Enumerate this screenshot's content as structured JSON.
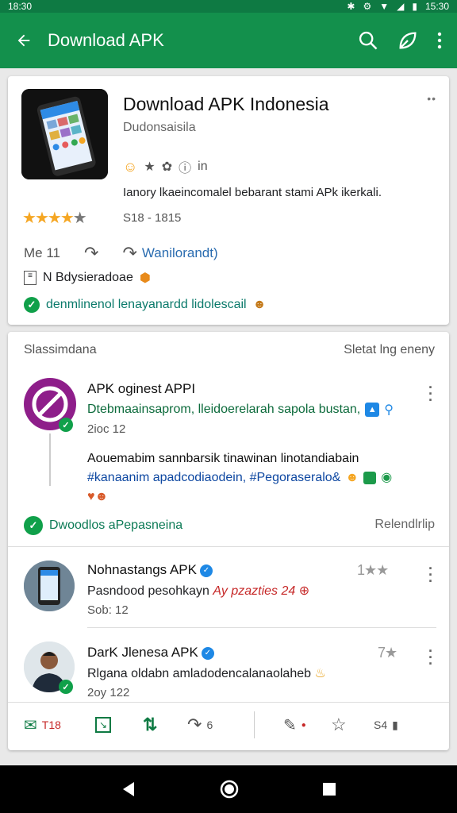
{
  "status_bar": {
    "left": "18:30",
    "right": "15:30"
  },
  "app_bar": {
    "title": "Download APK"
  },
  "header_card": {
    "title": "Download APK Indonesia",
    "developer": "Dudonsaisila",
    "badge_text": "in",
    "description": "Ianory lkaeincomalel bebarant stami APk ikerkali.",
    "rating_stars": 4.5,
    "range": "S18 - 1815",
    "action_count": "Me 11",
    "action_download": "Wanilorandt)",
    "info_text": "N Bdysieradoae",
    "verified_text": "denmlinenol lenayanardd lidolescail"
  },
  "feed_card": {
    "section_left": "Slassimdana",
    "section_right": "Sletat lng eneny",
    "post1": {
      "name": "APK oginest APPI",
      "subtitle": "Dtebmaainsaprom, lleidoerelarah sapola bustan,",
      "date": "2ioc 12",
      "body": "Aouemabim sannbarsik tinawinan linotandiabain",
      "tags": "#kanaanim apadcodiaodein, #Pegoraseralo&",
      "recommend": "Dwoodlos aPepasneina",
      "reply": "Relendlrlip"
    },
    "post2": {
      "name": "Nohnastangs APK",
      "subtitle": "Pasndood pesohkayn",
      "highlight": "Ay pzazties 24",
      "date": "Sob: 12",
      "rating": "1★★"
    },
    "post3": {
      "name": "DarK Jlenesa APK",
      "subtitle": "Rlgana oldabn amladodencalanaolaheb",
      "date": "2oy 122",
      "rating": "7★"
    },
    "bottom_actions": {
      "count1": "T18",
      "count2": "6",
      "count3": "S4"
    }
  }
}
